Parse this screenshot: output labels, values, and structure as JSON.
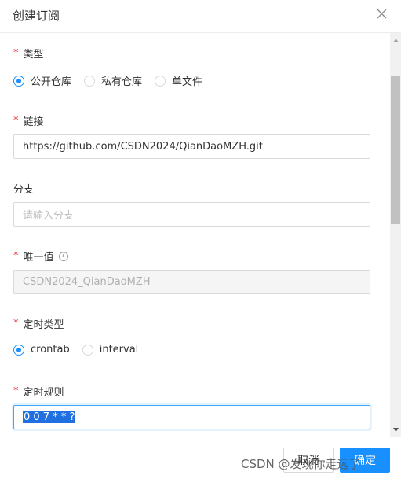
{
  "dialog": {
    "title": "创建订阅",
    "close_icon": "close-icon"
  },
  "form": {
    "type": {
      "required_mark": "*",
      "label": "类型",
      "options": [
        "公开仓库",
        "私有仓库",
        "单文件"
      ],
      "selected": "公开仓库"
    },
    "link": {
      "required_mark": "*",
      "label": "链接",
      "value": "https://github.com/CSDN2024/QianDaoMZH.git"
    },
    "branch": {
      "label": "分支",
      "placeholder": "请输入分支"
    },
    "unique_value": {
      "required_mark": "*",
      "label": "唯一值",
      "help_icon": "question-circle-icon",
      "help_glyph": "?",
      "value": "CSDN2024_QianDaoMZH"
    },
    "schedule_type": {
      "required_mark": "*",
      "label": "定时类型",
      "options": [
        "crontab",
        "interval"
      ],
      "selected": "crontab"
    },
    "schedule_rule": {
      "required_mark": "*",
      "label": "定时规则",
      "value": "0 0 7 * * ?"
    }
  },
  "footer": {
    "cancel_label": "取消",
    "ok_label": "确定"
  },
  "watermark": "CSDN @发现你走远了",
  "colors": {
    "accent": "#1890ff",
    "required": "#f5222d",
    "selection": "#1f6fe0"
  }
}
